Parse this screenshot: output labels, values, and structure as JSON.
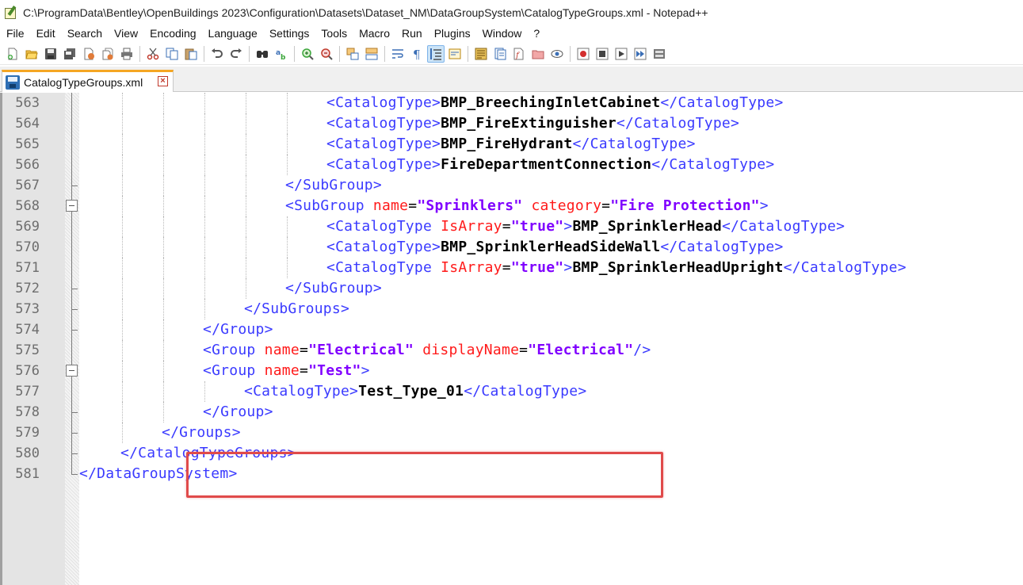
{
  "window": {
    "title": "C:\\ProgramData\\Bentley\\OpenBuildings 2023\\Configuration\\Datasets\\Dataset_NM\\DataGroupSystem\\CatalogTypeGroups.xml - Notepad++"
  },
  "menu": [
    "File",
    "Edit",
    "Search",
    "View",
    "Encoding",
    "Language",
    "Settings",
    "Tools",
    "Macro",
    "Run",
    "Plugins",
    "Window",
    "?"
  ],
  "tab": {
    "label": "CatalogTypeGroups.xml",
    "close": "×"
  },
  "lines": [
    {
      "n": "563",
      "indent": 6,
      "parts": [
        [
          "tag",
          "<CatalogType>"
        ],
        [
          "txt",
          "BMP_BreechingInletCabinet"
        ],
        [
          "tag",
          "</CatalogType>"
        ]
      ]
    },
    {
      "n": "564",
      "indent": 6,
      "parts": [
        [
          "tag",
          "<CatalogType>"
        ],
        [
          "txt",
          "BMP_FireExtinguisher"
        ],
        [
          "tag",
          "</CatalogType>"
        ]
      ]
    },
    {
      "n": "565",
      "indent": 6,
      "parts": [
        [
          "tag",
          "<CatalogType>"
        ],
        [
          "txt",
          "BMP_FireHydrant"
        ],
        [
          "tag",
          "</CatalogType>"
        ]
      ]
    },
    {
      "n": "566",
      "indent": 6,
      "parts": [
        [
          "tag",
          "<CatalogType>"
        ],
        [
          "txt",
          "FireDepartmentConnection"
        ],
        [
          "tag",
          "</CatalogType>"
        ]
      ]
    },
    {
      "n": "567",
      "indent": 5,
      "parts": [
        [
          "tag",
          "</SubGroup>"
        ]
      ]
    },
    {
      "n": "568",
      "indent": 5,
      "parts": [
        [
          "tag",
          "<SubGroup "
        ],
        [
          "attr",
          "name"
        ],
        [
          "eq",
          "="
        ],
        [
          "val",
          "\"Sprinklers\""
        ],
        [
          "attr",
          " category"
        ],
        [
          "eq",
          "="
        ],
        [
          "val",
          "\"Fire Protection\""
        ],
        [
          "tag",
          ">"
        ]
      ]
    },
    {
      "n": "569",
      "indent": 6,
      "parts": [
        [
          "tag",
          "<CatalogType "
        ],
        [
          "attr",
          "IsArray"
        ],
        [
          "eq",
          "="
        ],
        [
          "val",
          "\"true\""
        ],
        [
          "tag",
          ">"
        ],
        [
          "txt",
          "BMP_SprinklerHead"
        ],
        [
          "tag",
          "</CatalogType>"
        ]
      ]
    },
    {
      "n": "570",
      "indent": 6,
      "parts": [
        [
          "tag",
          "<CatalogType>"
        ],
        [
          "txt",
          "BMP_SprinklerHeadSideWall"
        ],
        [
          "tag",
          "</CatalogType>"
        ]
      ]
    },
    {
      "n": "571",
      "indent": 6,
      "parts": [
        [
          "tag",
          "<CatalogType "
        ],
        [
          "attr",
          "IsArray"
        ],
        [
          "eq",
          "="
        ],
        [
          "val",
          "\"true\""
        ],
        [
          "tag",
          ">"
        ],
        [
          "txt",
          "BMP_SprinklerHeadUpright"
        ],
        [
          "tag",
          "</CatalogType>"
        ]
      ]
    },
    {
      "n": "572",
      "indent": 5,
      "parts": [
        [
          "tag",
          "</SubGroup>"
        ]
      ]
    },
    {
      "n": "573",
      "indent": 4,
      "parts": [
        [
          "tag",
          "</SubGroups>"
        ]
      ]
    },
    {
      "n": "574",
      "indent": 3,
      "parts": [
        [
          "tag",
          "</Group>"
        ]
      ]
    },
    {
      "n": "575",
      "indent": 3,
      "parts": [
        [
          "tag",
          "<Group "
        ],
        [
          "attr",
          "name"
        ],
        [
          "eq",
          "="
        ],
        [
          "val",
          "\"Electrical\""
        ],
        [
          "attr",
          " displayName"
        ],
        [
          "eq",
          "="
        ],
        [
          "val",
          "\"Electrical\""
        ],
        [
          "tag",
          "/>"
        ]
      ]
    },
    {
      "n": "576",
      "indent": 3,
      "parts": [
        [
          "tag",
          "<Group "
        ],
        [
          "attr",
          "name"
        ],
        [
          "eq",
          "="
        ],
        [
          "val",
          "\"Test\""
        ],
        [
          "tag",
          ">"
        ]
      ]
    },
    {
      "n": "577",
      "indent": 4,
      "parts": [
        [
          "tag",
          "<CatalogType>"
        ],
        [
          "txt",
          "Test_Type_01"
        ],
        [
          "tag",
          "</CatalogType>"
        ]
      ]
    },
    {
      "n": "578",
      "indent": 3,
      "parts": [
        [
          "tag",
          "</Group>"
        ]
      ]
    },
    {
      "n": "579",
      "indent": 2,
      "parts": [
        [
          "tag",
          "</Groups>"
        ]
      ]
    },
    {
      "n": "580",
      "indent": 1,
      "parts": [
        [
          "tag",
          "</CatalogTypeGroups>"
        ]
      ]
    },
    {
      "n": "581",
      "indent": 0,
      "parts": [
        [
          "tag",
          "</DataGroupSystem>"
        ]
      ]
    }
  ],
  "colors": {
    "tag": "#3a3aff",
    "attribute": "#ff1a1a",
    "value": "#8000ff",
    "text": "#000000",
    "highlight": "#e04a4a",
    "tab_accent": "#f5a623"
  },
  "icons": [
    "new-file-icon",
    "open-file-icon",
    "save-icon",
    "save-all-icon",
    "close-icon",
    "close-all-icon",
    "print-icon",
    "cut-icon",
    "copy-icon",
    "paste-icon",
    "undo-icon",
    "redo-icon",
    "find-icon",
    "replace-icon",
    "zoom-in-icon",
    "zoom-out-icon",
    "sync-vertical-icon",
    "sync-horizontal-icon",
    "word-wrap-icon",
    "show-all-chars-icon",
    "indent-guide-icon",
    "udl-icon",
    "document-map-icon",
    "function-list-icon",
    "folder-workspace-icon",
    "monitoring-icon",
    "record-macro-icon",
    "stop-record-icon",
    "play-macro-icon",
    "run-macro-multiple-icon",
    "save-macro-icon"
  ]
}
